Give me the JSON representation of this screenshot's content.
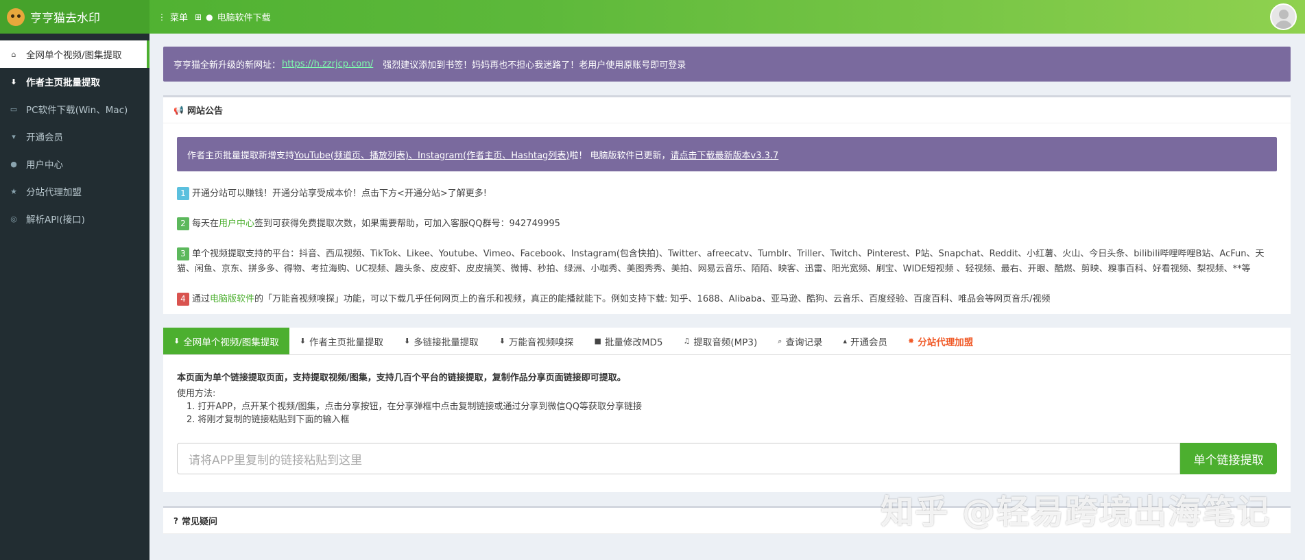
{
  "header": {
    "brand": "亨亨猫去水印",
    "menu_label": "菜单",
    "download_label": "电脑软件下载"
  },
  "sidebar": {
    "items": [
      {
        "label": "全网单个视频/图集提取",
        "icon": "home-icon"
      },
      {
        "label": "作者主页批量提取",
        "icon": "download-icon"
      },
      {
        "label": "PC软件下载(Win、Mac)",
        "icon": "desktop-icon"
      },
      {
        "label": "开通会员",
        "icon": "thumbs-down-icon"
      },
      {
        "label": "用户中心",
        "icon": "user-icon"
      },
      {
        "label": "分站代理加盟",
        "icon": "star-icon"
      },
      {
        "label": "解析API(接口)",
        "icon": "github-icon"
      }
    ]
  },
  "announcement": {
    "prefix": "亨亨猫全新升级的新网址：",
    "link": "https://h.zzrjcp.com/",
    "suffix": "强烈建议添加到书签！妈妈再也不担心我迷路了！老用户使用原账号即可登录"
  },
  "notice_box": {
    "title": "网站公告",
    "banner": {
      "t1": "作者主页批量提取新增支持 ",
      "u1": "YouTube(频道页、播放列表)、Instagram(作者主页、Hashtag列表)",
      "t2": " 啦！ 电脑版软件已更新，",
      "u2": "请点击下载最新版本v3.3.7"
    },
    "lines": [
      {
        "num": "1",
        "text": "开通分站可以赚钱！开通分站享受成本价！点击下方<开通分站>了解更多!"
      },
      {
        "num": "2",
        "pre": "每天在",
        "hl": "用户中心",
        "post": "签到可获得免费提取次数，如果需要帮助，可加入客服QQ群号：942749995"
      },
      {
        "num": "3",
        "text": "单个视频提取支持的平台：抖音、西瓜视频、TikTok、Likee、Youtube、Vimeo、Facebook、Instagram(包含快拍)、Twitter、afreecatv、Tumblr、Triller、Twitch、Pinterest、P站、Snapchat、Reddit、小红薯、火山、今日头条、bilibili哔哩哔哩B站、AcFun、天猫、闲鱼、京东、拼多多、得物、考拉海购、UC视频、趣头条、皮皮虾、皮皮搞笑、微博、秒拍、绿洲、小咖秀、美图秀秀、美拍、网易云音乐、陌陌、映客、迅雷、阳光宽频、刷宝、WIDE短视频 、轻视频、最右、开眼、酷燃、剪映、糗事百科、好看视频、梨视频、**等"
      },
      {
        "num": "4",
        "pre": "通过",
        "hl": "电脑版软件",
        "post": "的「万能音视频嗅探」功能，可以下载几乎任何网页上的音乐和视频，真正的能播就能下。例如支持下载: 知乎、1688、Alibaba、亚马逊、酷狗、云音乐、百度经验、百度百科、唯品会等网页音乐/视频"
      }
    ]
  },
  "tabs": [
    {
      "label": "全网单个视频/图集提取",
      "icon": "download-icon"
    },
    {
      "label": "作者主页批量提取",
      "icon": "download-icon"
    },
    {
      "label": "多链接批量提取",
      "icon": "download-icon"
    },
    {
      "label": "万能音视频嗅探",
      "icon": "download-icon"
    },
    {
      "label": "批量修改MD5",
      "icon": "video-camera-icon"
    },
    {
      "label": "提取音频(MP3)",
      "icon": "music-icon"
    },
    {
      "label": "查询记录",
      "icon": "search-icon"
    },
    {
      "label": "开通会员",
      "icon": "thumbs-up-icon"
    },
    {
      "label": "分站代理加盟",
      "icon": "sun-icon"
    }
  ],
  "extract": {
    "intro": "本页面为单个链接提取页面，支持提取视频/图集，支持几百个平台的链接提取，复制作品分享页面链接即可提取。",
    "usage_title": "使用方法:",
    "steps": [
      "1. 打开APP，点开某个视频/图集，点击分享按钮，在分享弹框中点击复制链接或通过分享到微信QQ等获取分享链接",
      "2. 将刚才复制的链接粘贴到下面的输入框"
    ],
    "placeholder": "请将APP里复制的链接粘贴到这里",
    "button": "单个链接提取"
  },
  "faq": {
    "title": "常见疑问"
  },
  "watermark": "知乎 @轻易跨境出海笔记"
}
